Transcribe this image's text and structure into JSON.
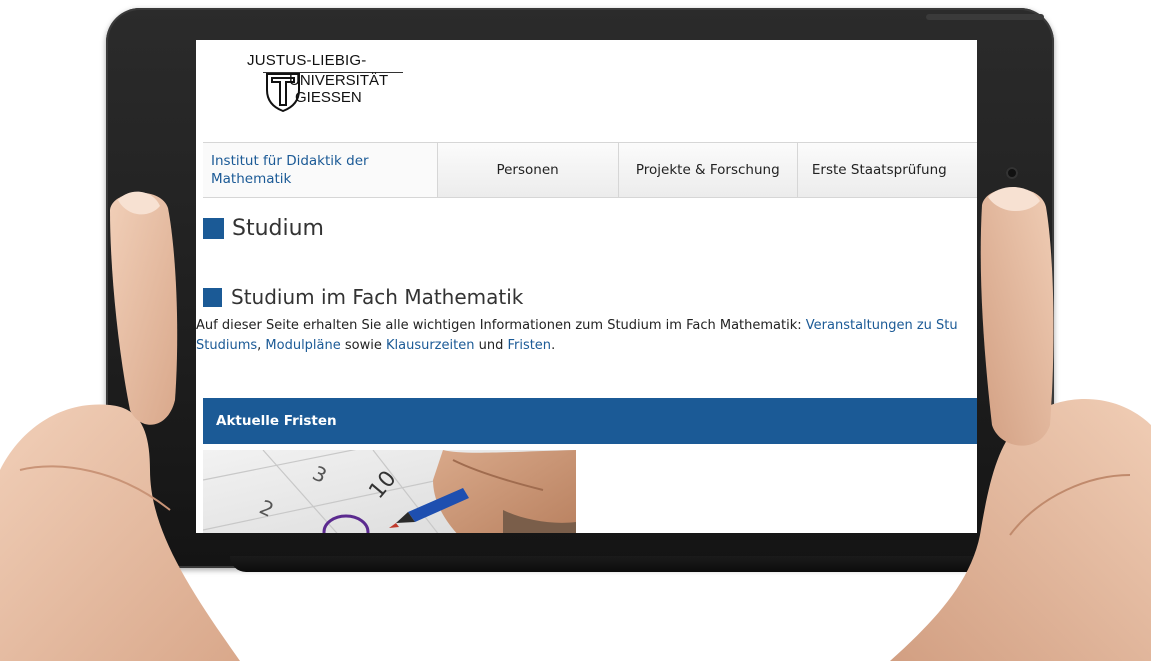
{
  "logo": {
    "line1": "JUSTUS-LIEBIG-",
    "line2": "UNIVERSITÄT",
    "line3": "GIESSEN"
  },
  "nav": {
    "items": [
      "Institut für Didaktik der Mathematik",
      "Personen",
      "Projekte & Forschung",
      "Erste Staatsprüfung"
    ]
  },
  "page": {
    "title": "Studium",
    "section_title": "Studium im Fach Mathematik",
    "intro_prefix": "Auf dieser Seite erhalten Sie alle wichtigen Informationen zum Studium im Fach Mathematik: ",
    "intro_link1": "Veranstaltungen zu Stu",
    "intro_link2": "Studiums",
    "intro_sep": ", ",
    "intro_link3": "Modulpläne",
    "intro_mid": " sowie ",
    "intro_link4": "Klausurzeiten",
    "intro_and": " und ",
    "intro_link5": "Fristen",
    "intro_end": ".",
    "bar_label": "Aktuelle Fristen"
  },
  "colors": {
    "accent": "#1b5a96",
    "tablet": "#1e1e1e"
  }
}
